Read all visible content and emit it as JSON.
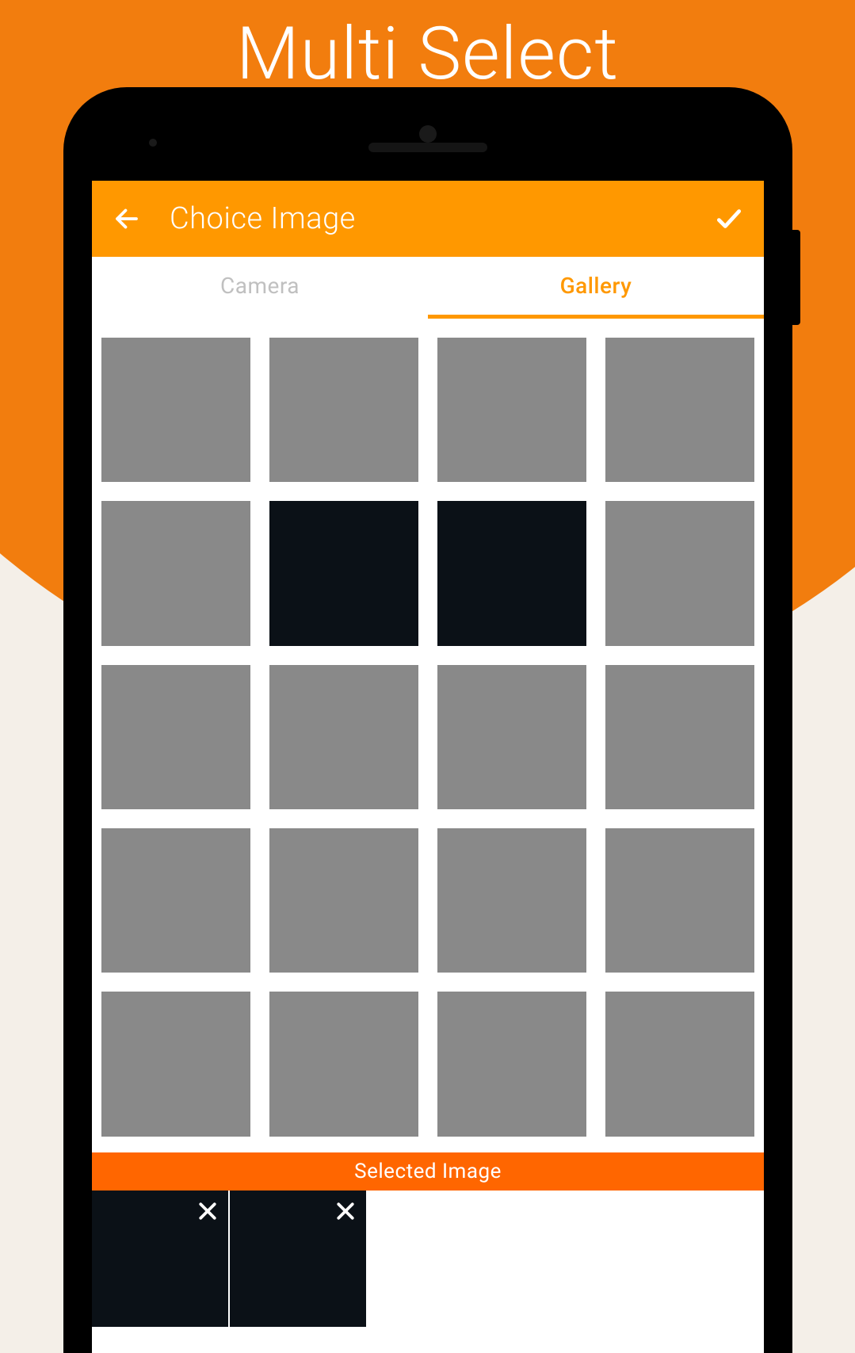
{
  "promo": {
    "title": "Multi Select"
  },
  "appbar": {
    "title": "Choice Image"
  },
  "tabs": [
    {
      "label": "Camera",
      "active": false
    },
    {
      "label": "Gallery",
      "active": true
    }
  ],
  "grid": {
    "rows": 5,
    "cols": 4,
    "thumbs": [
      {
        "dark": false
      },
      {
        "dark": false
      },
      {
        "dark": false
      },
      {
        "dark": false
      },
      {
        "dark": false
      },
      {
        "dark": true
      },
      {
        "dark": true
      },
      {
        "dark": false
      },
      {
        "dark": false
      },
      {
        "dark": false
      },
      {
        "dark": false
      },
      {
        "dark": false
      },
      {
        "dark": false
      },
      {
        "dark": false
      },
      {
        "dark": false
      },
      {
        "dark": false
      },
      {
        "dark": false
      },
      {
        "dark": false
      },
      {
        "dark": false
      },
      {
        "dark": false
      }
    ]
  },
  "selected": {
    "label": "Selected Image",
    "items": [
      {},
      {}
    ]
  },
  "colors": {
    "accent": "#ff9800",
    "accent2": "#ff6600",
    "thumb": "#898989",
    "thumbDark": "#0b1117"
  }
}
